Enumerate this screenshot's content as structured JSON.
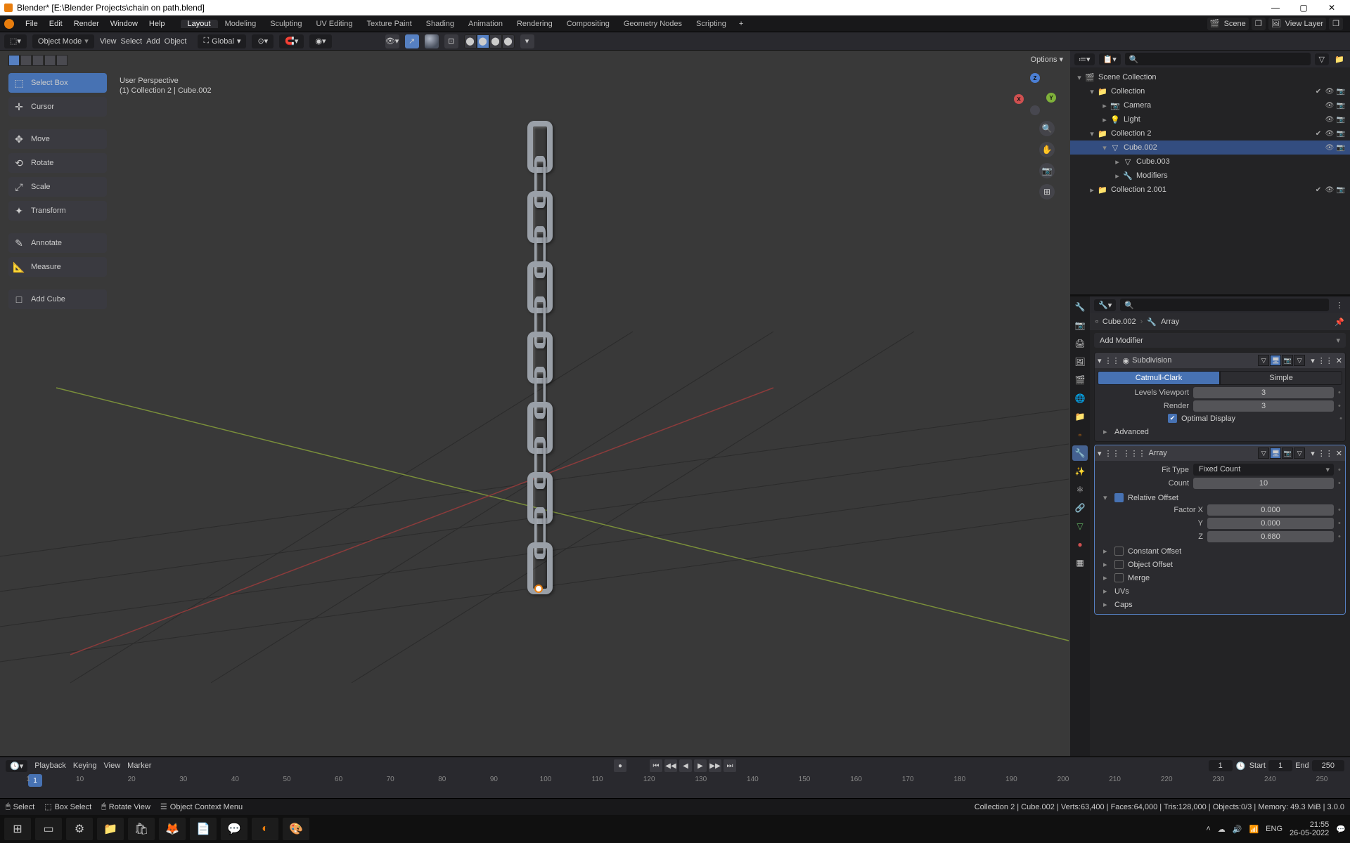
{
  "window": {
    "title": "Blender* [E:\\Blender Projects\\chain on path.blend]"
  },
  "menus": [
    "File",
    "Edit",
    "Render",
    "Window",
    "Help"
  ],
  "workspaces": [
    "Layout",
    "Modeling",
    "Sculpting",
    "UV Editing",
    "Texture Paint",
    "Shading",
    "Animation",
    "Rendering",
    "Compositing",
    "Geometry Nodes",
    "Scripting"
  ],
  "scene_label": "Scene",
  "viewlayer_label": "View Layer",
  "header": {
    "mode": "Object Mode",
    "view": "View",
    "select": "Select",
    "add": "Add",
    "object": "Object",
    "orient": "Global",
    "options": "Options"
  },
  "info": {
    "l1": "User Perspective",
    "l2": "(1) Collection 2 | Cube.002"
  },
  "tools": [
    {
      "name": "Select Box",
      "icon": "⬚",
      "active": true
    },
    {
      "name": "Cursor",
      "icon": "✛"
    },
    {
      "name": "Move",
      "icon": "✥"
    },
    {
      "name": "Rotate",
      "icon": "⟲"
    },
    {
      "name": "Scale",
      "icon": "⤢"
    },
    {
      "name": "Transform",
      "icon": "✦"
    },
    {
      "name": "Annotate",
      "icon": "✎"
    },
    {
      "name": "Measure",
      "icon": "📏"
    },
    {
      "name": "Add Cube",
      "icon": "□"
    }
  ],
  "outliner": {
    "search_placeholder": "",
    "rows": [
      {
        "depth": 0,
        "exp": "▾",
        "icon": "🎬",
        "label": "Scene Collection",
        "togs": []
      },
      {
        "depth": 1,
        "exp": "▾",
        "icon": "📁",
        "label": "Collection",
        "togs": [
          "✔",
          "👁",
          "📷"
        ]
      },
      {
        "depth": 2,
        "exp": "▸",
        "icon": "📷",
        "label": "Camera",
        "extra": "cam",
        "togs": [
          "👁",
          "📷"
        ]
      },
      {
        "depth": 2,
        "exp": "▸",
        "icon": "💡",
        "label": "Light",
        "extra": "light",
        "togs": [
          "👁",
          "📷"
        ]
      },
      {
        "depth": 1,
        "exp": "▾",
        "icon": "📁",
        "label": "Collection 2",
        "togs": [
          "✔",
          "👁",
          "📷"
        ]
      },
      {
        "depth": 2,
        "exp": "▾",
        "icon": "▽",
        "label": "Cube.002",
        "selected": true,
        "togs": [
          "👁",
          "📷"
        ]
      },
      {
        "depth": 3,
        "exp": "▸",
        "icon": "▽",
        "label": "Cube.003",
        "extra": "mesh",
        "togs": []
      },
      {
        "depth": 3,
        "exp": "▸",
        "icon": "🔧",
        "label": "Modifiers",
        "extra": "mods",
        "togs": []
      },
      {
        "depth": 1,
        "exp": "▸",
        "icon": "📁",
        "label": "Collection 2.001",
        "extra": "link",
        "togs": [
          "✔",
          "👁",
          "📷"
        ]
      }
    ]
  },
  "crumb": {
    "obj": "Cube.002",
    "mod": "Array"
  },
  "add_modifier": "Add Modifier",
  "subsurf": {
    "name": "Subdivision",
    "algo_a": "Catmull-Clark",
    "algo_b": "Simple",
    "levels_lbl": "Levels Viewport",
    "levels": "3",
    "render_lbl": "Render",
    "render": "3",
    "optimal": "Optimal Display",
    "advanced": "Advanced"
  },
  "array": {
    "name": "Array",
    "fit_lbl": "Fit Type",
    "fit": "Fixed Count",
    "count_lbl": "Count",
    "count": "10",
    "reloff": "Relative Offset",
    "fx_lbl": "Factor X",
    "fx": "0.000",
    "fy_lbl": "Y",
    "fy": "0.000",
    "fz_lbl": "Z",
    "fz": "0.680",
    "constoff": "Constant Offset",
    "objoff": "Object Offset",
    "merge": "Merge",
    "uvs": "UVs",
    "caps": "Caps"
  },
  "timeline": {
    "playback": "Playback",
    "keying": "Keying",
    "view": "View",
    "marker": "Marker",
    "frame": "1",
    "start_lbl": "Start",
    "start": "1",
    "end_lbl": "End",
    "end": "250",
    "ticks": [
      "1",
      "10",
      "20",
      "30",
      "40",
      "50",
      "60",
      "70",
      "80",
      "90",
      "100",
      "110",
      "120",
      "130",
      "140",
      "150",
      "160",
      "170",
      "180",
      "190",
      "200",
      "210",
      "220",
      "230",
      "240",
      "250"
    ]
  },
  "status": {
    "select": "Select",
    "box": "Box Select",
    "rotate": "Rotate View",
    "menu": "Object Context Menu",
    "right": "Collection 2 | Cube.002 | Verts:63,400 | Faces:64,000 | Tris:128,000 | Objects:0/3 | Memory: 49.3 MiB | 3.0.0"
  },
  "clock": {
    "time": "21:55",
    "date": "26-05-2022"
  },
  "lang": "ENG"
}
